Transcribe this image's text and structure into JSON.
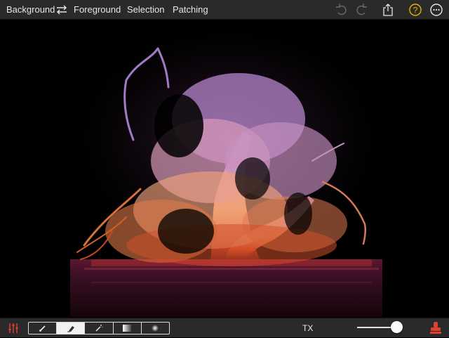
{
  "toolbar": {
    "background_label": "Background",
    "foreground_label": "Foreground",
    "selection_label": "Selection",
    "patching_label": "Patching",
    "icons": [
      "swap-icon",
      "undo-icon",
      "redo-icon",
      "share-icon",
      "help-icon"
    ]
  },
  "bottom": {
    "tools": [
      "brush-icon",
      "eraser-icon",
      "magic-wand-icon",
      "gradient-icon",
      "soft-brush-icon"
    ],
    "active_tool_index": 1,
    "tx_label": "TX",
    "slider_value": 0.9,
    "icons": [
      "adjustments-icon",
      "stamp-icon"
    ]
  },
  "colors": {
    "bar_bg": "#2a2a2a",
    "accent_red": "#e0412f",
    "help_yellow": "#e8b400"
  }
}
